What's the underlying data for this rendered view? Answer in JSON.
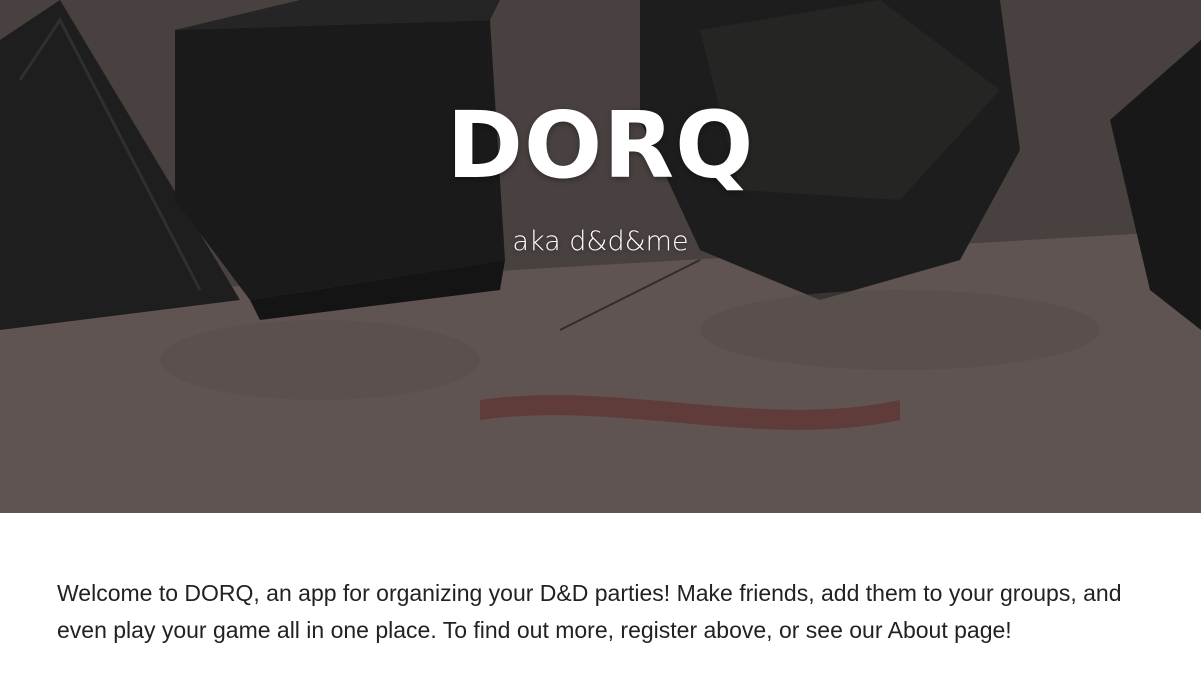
{
  "hero": {
    "title": "DORQ",
    "subtitle": "aka d&d&me",
    "background_image": "dice-on-map-photo"
  },
  "intro": {
    "text": "Welcome to DORQ, an app for organizing your D&D parties! Make friends, add them to your groups, and even play your game all in one place. To find out more, register above, or see our About page!"
  },
  "colors": {
    "hero_overlay": "#2a2525",
    "title_text": "#ffffff",
    "body_text": "#222222",
    "page_background": "#ffffff"
  }
}
